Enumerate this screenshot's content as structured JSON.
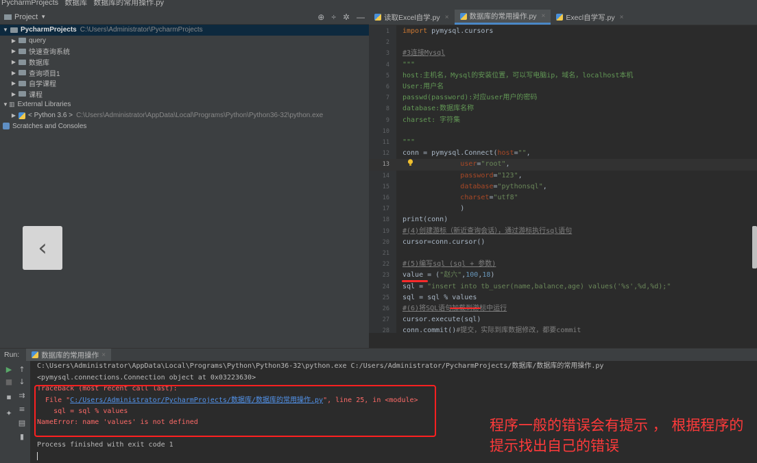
{
  "breadcrumb": [
    "PycharmProjects",
    "数据库",
    "数据库的常用操作.py"
  ],
  "project": {
    "header": "Project",
    "tools": [
      "⊕",
      "÷",
      "✲",
      "—"
    ],
    "root": {
      "name": "PycharmProjects",
      "path": "C:\\Users\\Administrator\\PycharmProjects"
    },
    "folders": [
      "query",
      "快速查询系统",
      "数据库",
      "查询项目1",
      "自学课程",
      "课程"
    ],
    "external_libraries": "External Libraries",
    "python_env": {
      "name": "< Python 3.6 >",
      "path": "C:\\Users\\Administrator\\AppData\\Local\\Programs\\Python\\Python36-32\\python.exe"
    },
    "scratches": "Scratches and Consoles"
  },
  "tabs": [
    {
      "label": "读取Excel自学.py",
      "active": false
    },
    {
      "label": "数据库的常用操作.py",
      "active": true
    },
    {
      "label": "Execl自学写.py",
      "active": false
    }
  ],
  "editor": {
    "line_numbers": [
      "1",
      "2",
      "3",
      "4",
      "5",
      "6",
      "7",
      "8",
      "9",
      "10",
      "11",
      "12",
      "13",
      "14",
      "15",
      "16",
      "17",
      "18",
      "19",
      "20",
      "21",
      "22",
      "23",
      "24",
      "25",
      "26",
      "27",
      "28"
    ],
    "current_line": 13,
    "lines": [
      "import pymysql.cursors",
      "",
      "#3连接Mysql",
      "\"\"\"",
      "host:主机名，Mysql的安装位置，可以写电脑ip，域名，localhost本机",
      "User:用户名",
      "passwd(password):对应user用户的密码",
      "database:数据库名称",
      "charset: 字符集",
      "",
      "\"\"\"",
      "conn = pymysql.Connect(host=\"\",",
      "              user=\"root\",",
      "              password=\"123\",",
      "              database=\"pythonsql\",",
      "              charset=\"utf8\"",
      "              )",
      "print(conn)",
      "#(4)创建游标（新近查询会话），通过游标执行sql语句",
      "cursor=conn.cursor()",
      "",
      "#(5)编写sql (sql + 参数)",
      "value = (\"赵六\",100,18)",
      "sql = \"insert into tb_user(name,balance,age) values('%s',%d,%d);\"",
      "sql = sql % values",
      "#(6)将SQL语句加载到游标中运行",
      "cursor.execute(sql)",
      "conn.commit()#提交，实际到库数据修改，都要commit"
    ]
  },
  "run": {
    "label": "Run:",
    "tab": "数据库的常用操作",
    "output": [
      {
        "type": "norm",
        "text": "C:\\Users\\Administrator\\AppData\\Local\\Programs\\Python\\Python36-32\\python.exe C:/Users/Administrator/PycharmProjects/数据库/数据库的常用操作.py"
      },
      {
        "type": "norm",
        "text": "<pymysql.connections.Connection object at 0x03223630>"
      },
      {
        "type": "err",
        "text": "Traceback (most recent call last):"
      },
      {
        "type": "err",
        "pre": "  File \"",
        "link": "C:/Users/Administrator/PycharmProjects/数据库/数据库的常用操作.py",
        "post": "\", line 25, in <module>"
      },
      {
        "type": "err",
        "text": "    sql = sql % values"
      },
      {
        "type": "err",
        "text": "NameError: name 'values' is not defined"
      },
      {
        "type": "norm",
        "text": ""
      },
      {
        "type": "norm",
        "text": "Process finished with exit code 1"
      }
    ]
  },
  "annotation": "程序一般的错误会有提示 ， 根据程序的提示找出自己的错误",
  "colors": {
    "annotation_red": "#ff2020",
    "keyword": "#cc7832",
    "string": "#6a8759",
    "error_text": "#ff6b68",
    "link": "#5394ec"
  }
}
